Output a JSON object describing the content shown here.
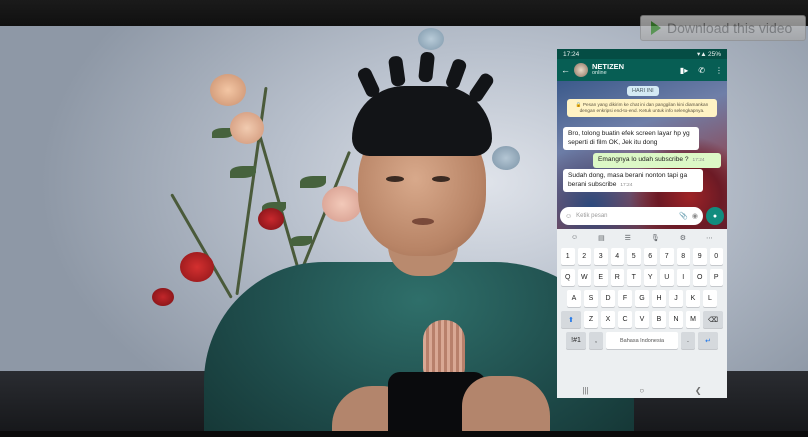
{
  "player": {
    "download_label": "Download this video",
    "colors": {
      "download_bg": "#b9b9b9",
      "play_icon": "#3c8a2e"
    }
  },
  "phone": {
    "status": {
      "time": "17:24",
      "battery": "25%",
      "icons": "signal-wifi-battery-icons"
    },
    "chat": {
      "contact_name": "NETIZEN",
      "contact_status": "online",
      "day_label": "HARI INI",
      "encryption_notice": "🔒 Pesan yang dikirim ke chat ini dan panggilan kini diamankan dengan enkripsi end-to-end. Ketuk untuk info selengkapnya.",
      "messages": [
        {
          "direction": "in",
          "text": "Bro, tolong buatin efek screen layar hp yg seperti di film OK, Jek itu dong",
          "time": ""
        },
        {
          "direction": "out",
          "text": "Emangnya lo udah subscribe ?",
          "time": "17:24"
        },
        {
          "direction": "in",
          "text": "Sudah dong, masa berani nonton tapi ga berani subscribe",
          "time": "17:24"
        }
      ],
      "input_placeholder": "Ketik pesan",
      "colors": {
        "header": "#075e54",
        "out_bubble": "#dcf8c6",
        "in_bubble": "#ffffff",
        "accent": "#128c7e"
      }
    },
    "keyboard": {
      "toolbar_icons": [
        "sticker-icon",
        "gif-icon",
        "clipboard-icon",
        "voice-icon",
        "settings-icon",
        "more-icon"
      ],
      "toolbar_glyphs": [
        "☺",
        "▤",
        "☰",
        "🎙",
        "⚙",
        "⋯"
      ],
      "number_row": [
        "1",
        "2",
        "3",
        "4",
        "5",
        "6",
        "7",
        "8",
        "9",
        "0"
      ],
      "row1": [
        "Q",
        "W",
        "E",
        "R",
        "T",
        "Y",
        "U",
        "I",
        "O",
        "P"
      ],
      "row2": [
        "A",
        "S",
        "D",
        "F",
        "G",
        "H",
        "J",
        "K",
        "L"
      ],
      "row3": [
        "Z",
        "X",
        "C",
        "V",
        "B",
        "N",
        "M"
      ],
      "symbols_key": "!#1",
      "comma_key": ",",
      "space_label": "Bahasa Indonesia",
      "period_key": ".",
      "shift_glyph": "⬆",
      "backspace_glyph": "⌫",
      "enter_glyph": "↵"
    },
    "navbar": {
      "recent": "|||",
      "home": "○",
      "back": "❮"
    }
  }
}
